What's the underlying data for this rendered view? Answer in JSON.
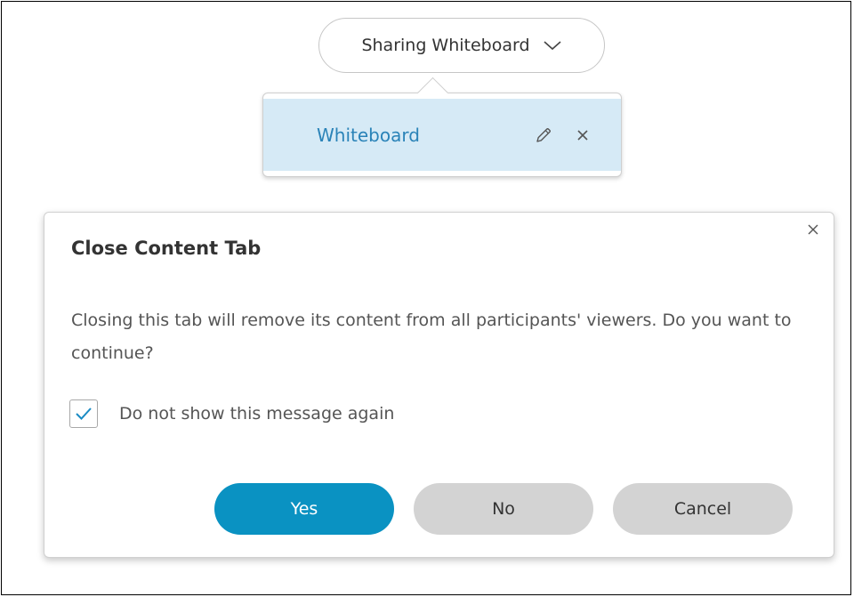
{
  "share": {
    "label": "Sharing Whiteboard",
    "icon": "chevron-down-icon"
  },
  "tab_menu": {
    "items": [
      {
        "label": "Whiteboard",
        "rename_icon": "pencil-icon",
        "close_icon": "close-icon"
      }
    ]
  },
  "dialog": {
    "title": "Close Content Tab",
    "message": "Closing this tab will remove its content from all participants' viewers. Do you want to continue?",
    "checkbox_label": "Do not show this message again",
    "checkbox_checked": true,
    "buttons": {
      "yes": "Yes",
      "no": "No",
      "cancel": "Cancel"
    }
  },
  "colors": {
    "primary": "#0a92c2",
    "tab_highlight": "#d6eaf6",
    "tab_text": "#2a83b8",
    "secondary_button": "#d3d3d3"
  }
}
